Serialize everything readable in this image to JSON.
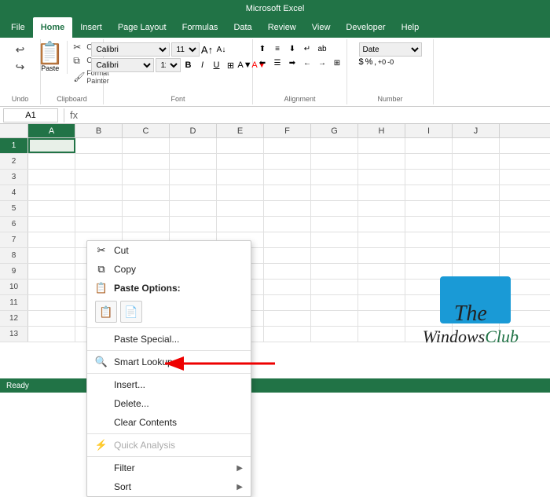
{
  "titleBar": {
    "title": "Microsoft Excel"
  },
  "ribbonTabs": {
    "tabs": [
      "File",
      "Home",
      "Insert",
      "Page Layout",
      "Formulas",
      "Data",
      "Review",
      "View",
      "Developer",
      "Help"
    ]
  },
  "ribbon": {
    "undoLabel": "Undo",
    "redoLabel": "Redo",
    "pasteLabel": "Paste",
    "cutLabel": "Cut",
    "copyLabel": "Copy",
    "formatPainterLabel": "Format Painter",
    "fontName": "Calibri",
    "fontSize": "11",
    "numberFormat": "Date",
    "groupLabels": {
      "undo": "Undo",
      "clipboard": "Clipboard",
      "font": "Font",
      "alignment": "Alignment",
      "number": "Number"
    }
  },
  "formulaBar": {
    "nameBox": "A1",
    "value": ""
  },
  "colHeaders": [
    "A",
    "B",
    "C",
    "D",
    "E",
    "F",
    "G",
    "H",
    "I",
    "J"
  ],
  "rowNumbers": [
    1,
    2,
    3,
    4,
    5,
    6,
    7,
    8,
    9,
    10,
    11,
    12,
    13
  ],
  "contextMenu": {
    "items": [
      {
        "id": "cut",
        "icon": "✂",
        "label": "Cut",
        "disabled": false,
        "hasArrow": false
      },
      {
        "id": "copy",
        "icon": "📋",
        "label": "Copy",
        "disabled": false,
        "hasArrow": false
      },
      {
        "id": "paste-options-header",
        "icon": "📋",
        "label": "Paste Options:",
        "disabled": false,
        "hasArrow": false,
        "isPasteHeader": true
      },
      {
        "id": "paste-special",
        "icon": "",
        "label": "Paste Special...",
        "disabled": false,
        "hasArrow": false
      },
      {
        "id": "smart-lookup",
        "icon": "🔍",
        "label": "Smart Lookup",
        "disabled": false,
        "hasArrow": false
      },
      {
        "id": "insert",
        "icon": "",
        "label": "Insert...",
        "disabled": false,
        "hasArrow": false
      },
      {
        "id": "delete",
        "icon": "",
        "label": "Delete...",
        "disabled": false,
        "hasArrow": false
      },
      {
        "id": "clear-contents",
        "icon": "",
        "label": "Clear Contents",
        "disabled": false,
        "hasArrow": false
      },
      {
        "id": "quick-analysis",
        "icon": "⚡",
        "label": "Quick Analysis",
        "disabled": true,
        "hasArrow": false
      },
      {
        "id": "filter",
        "icon": "",
        "label": "Filter",
        "disabled": false,
        "hasArrow": true
      },
      {
        "id": "sort",
        "icon": "",
        "label": "Sort",
        "disabled": false,
        "hasArrow": true
      }
    ]
  },
  "watermark": {
    "line1": "The",
    "line2": "WindowsClub"
  },
  "statusBar": {
    "ready": "Ready"
  }
}
